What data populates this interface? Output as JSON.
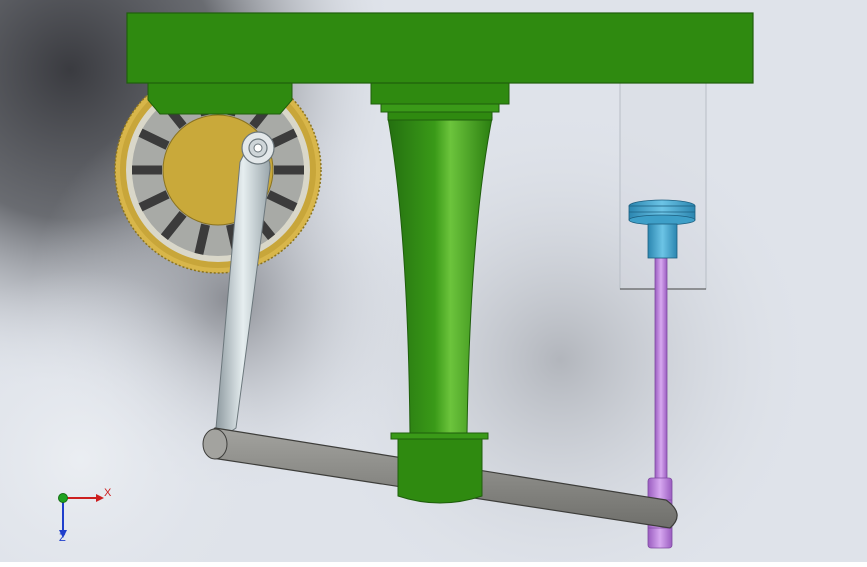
{
  "viewport": {
    "background_light": "#dfe3ea",
    "background_dark": "#3e3f44"
  },
  "model": {
    "colors": {
      "frame_green": "#2f8a10",
      "frame_green_light": "#56b82c",
      "gear_gold": "#c8a63a",
      "hub_gold": "#c9a93a",
      "connecting_rod": "#b9c4c8",
      "lever_gray": "#8c8c88",
      "piston_blue": "#3e9fc8",
      "push_rod_purple": "#b57bd6",
      "cylinder_glass": "#d6dbe1"
    }
  },
  "triad": {
    "x_label": "X",
    "z_label": "Z",
    "x_color": "#cc1f1f",
    "z_color": "#1f3fcc",
    "y_color": "#1fa21f"
  }
}
